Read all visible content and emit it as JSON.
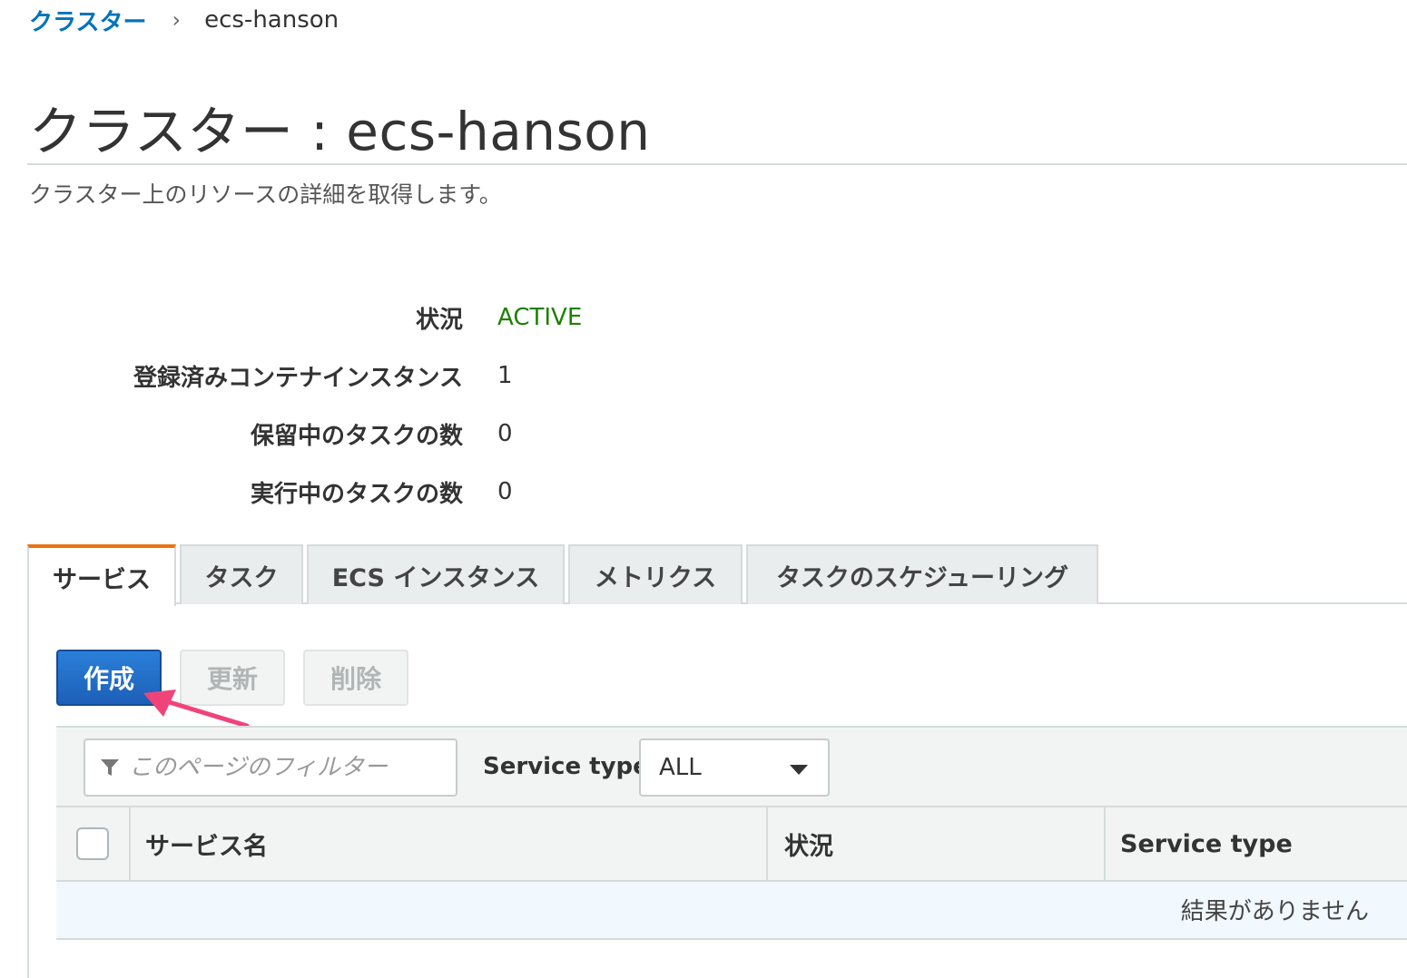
{
  "breadcrumb": {
    "parent": "クラスター",
    "separator": "›",
    "current": "ecs-hanson"
  },
  "page": {
    "title": "クラスター : ecs-hanson",
    "description": "クラスター上のリソースの詳細を取得します。"
  },
  "details": [
    {
      "label": "状況",
      "value": "ACTIVE"
    },
    {
      "label": "登録済みコンテナインスタンス",
      "value": "1"
    },
    {
      "label": "保留中のタスクの数",
      "value": "0"
    },
    {
      "label": "実行中のタスクの数",
      "value": "0"
    }
  ],
  "tabs": [
    {
      "label": "サービス",
      "active": true
    },
    {
      "label": "タスク",
      "active": false
    },
    {
      "label": "ECS インスタンス",
      "active": false
    },
    {
      "label": "メトリクス",
      "active": false
    },
    {
      "label": "タスクのスケジューリング",
      "active": false
    }
  ],
  "actions": {
    "create": "作成",
    "update": "更新",
    "delete": "削除"
  },
  "filter": {
    "placeholder": "このページのフィルター",
    "service_type_label": "Service type",
    "service_type_value": "ALL"
  },
  "table": {
    "columns": [
      "サービス名",
      "状況",
      "Service type"
    ],
    "empty_message": "結果がありません"
  },
  "colors": {
    "primary": "#1d6fc8",
    "active_status": "#1d8102",
    "tab_accent": "#ec7211",
    "annotation_arrow": "#f0437a"
  },
  "icons": [
    "chevron-right-icon",
    "filter-icon",
    "caret-down-icon",
    "arrow-annotation-icon"
  ]
}
